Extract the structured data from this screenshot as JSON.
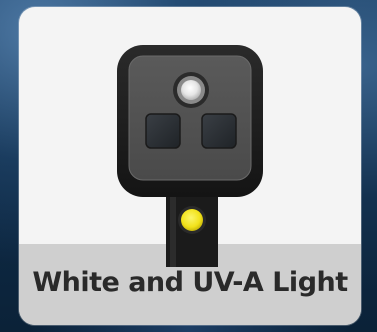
{
  "product": {
    "caption": "White and UV-A Light"
  },
  "icons": {
    "white_light": "white-led-icon",
    "uv_windows": "uv-led-icon",
    "indicator": "indicator-led-icon"
  },
  "colors": {
    "background": "#0d2a44",
    "card": "#f4f4f4",
    "label_band": "#cfcfcf",
    "caption_text": "#2a2a2a",
    "device_body": "#1c1c1c",
    "indicator": "#f2e21a"
  }
}
